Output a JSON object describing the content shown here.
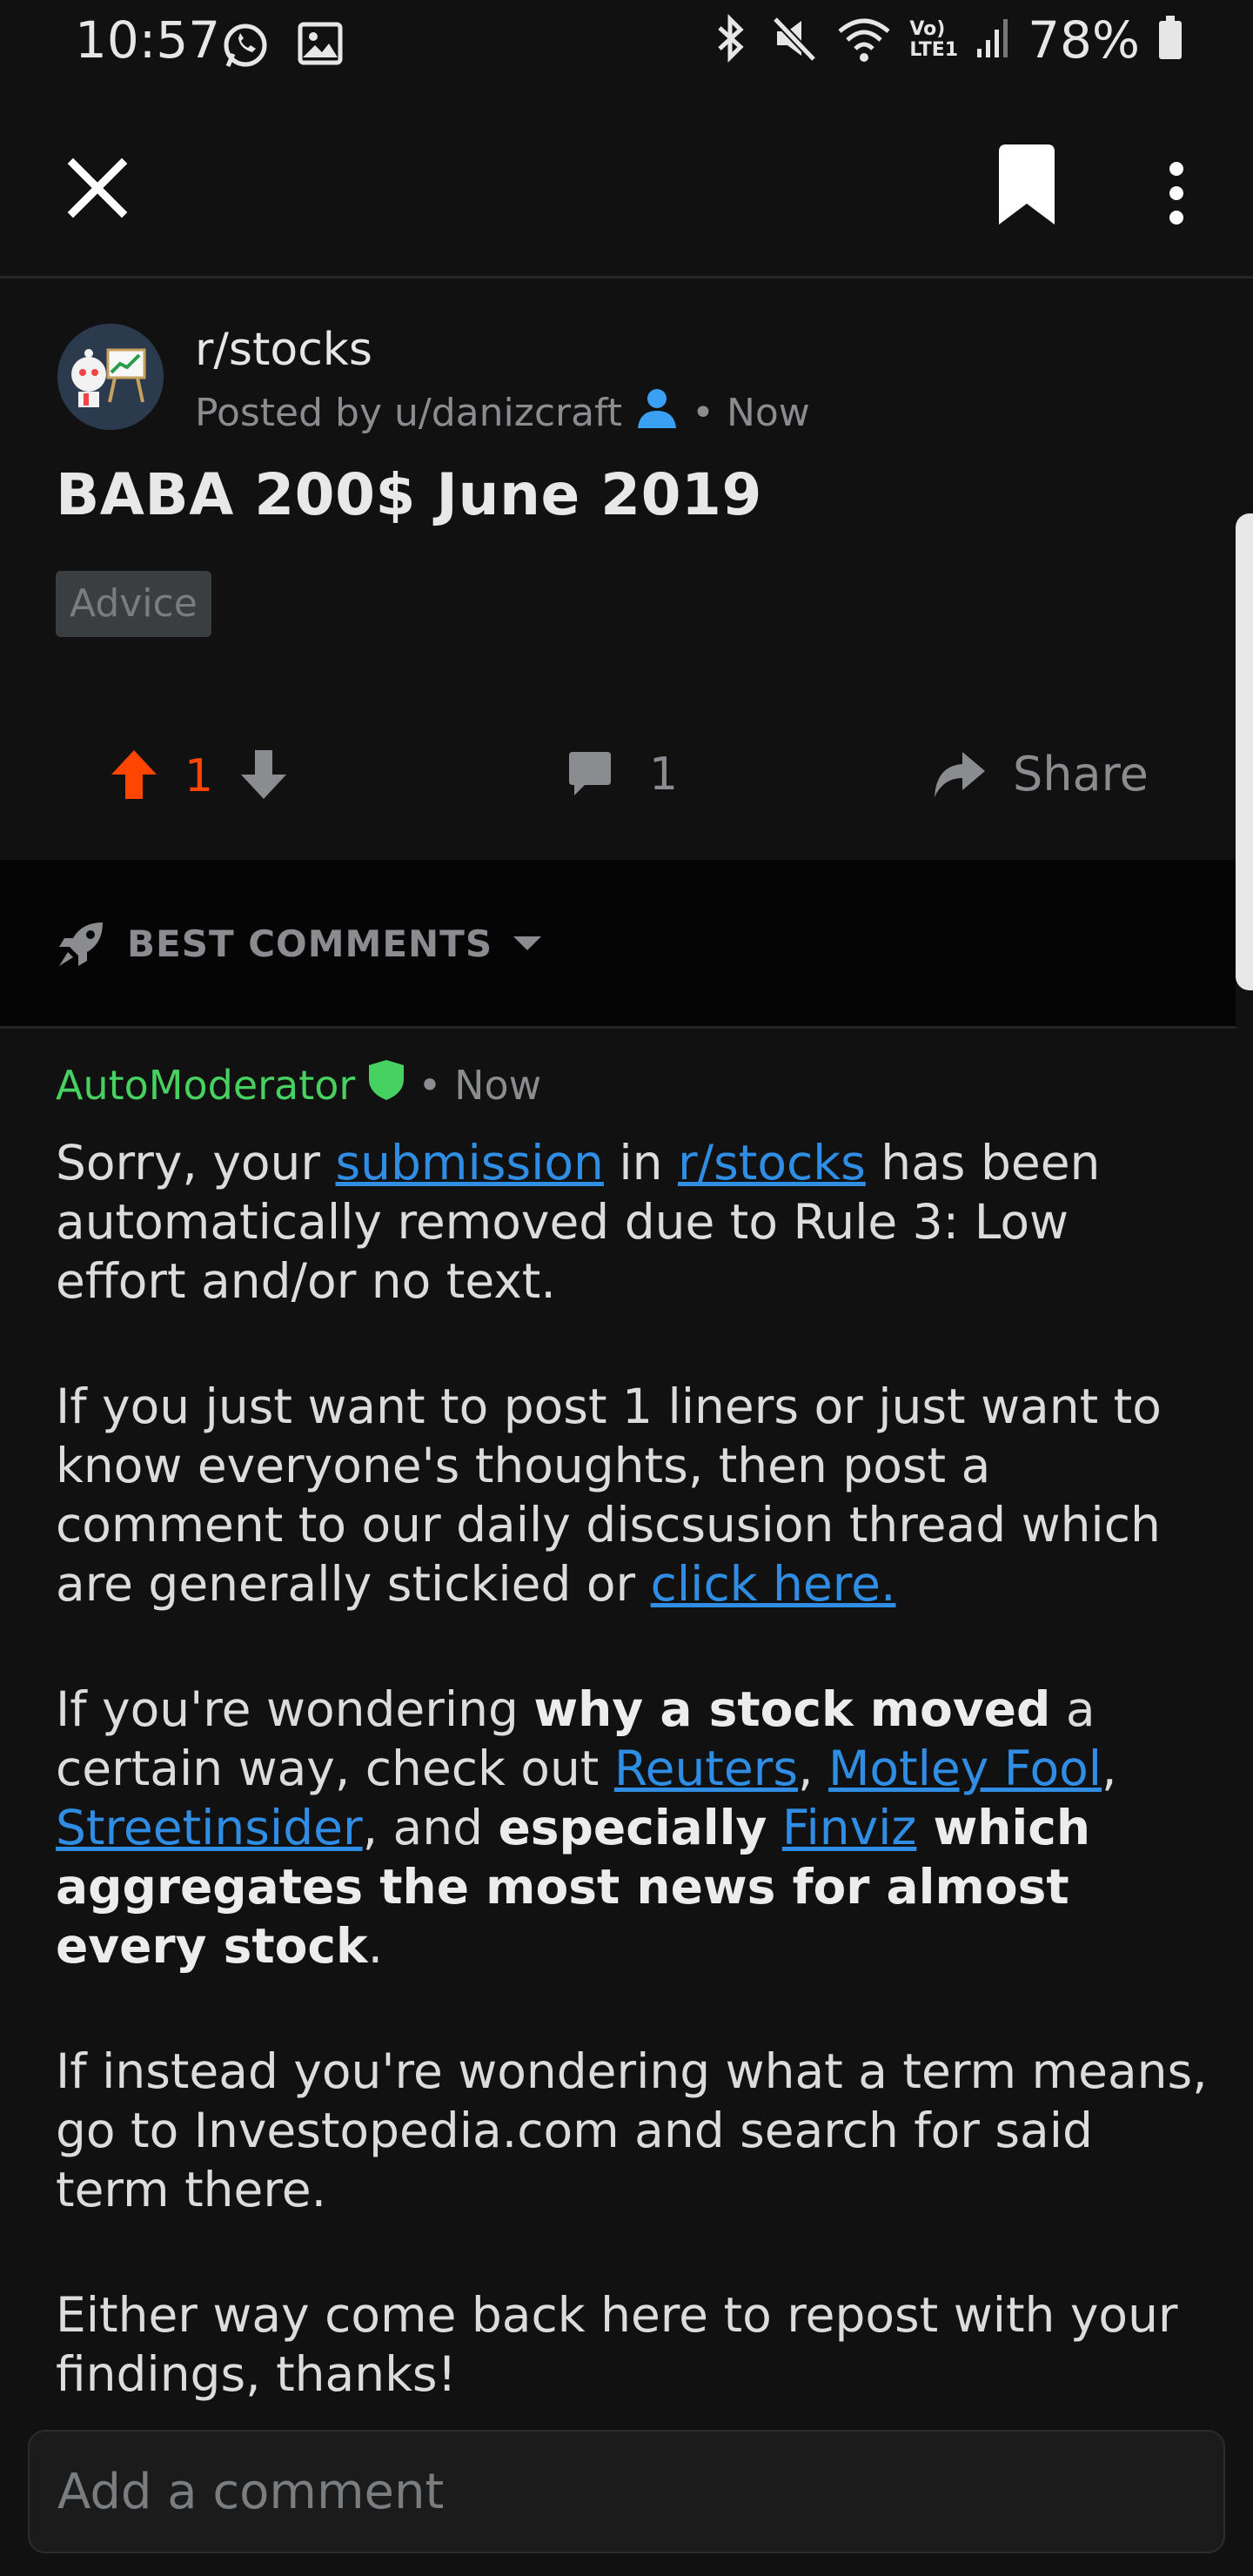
{
  "status_bar": {
    "time": "10:57",
    "battery": "78%",
    "icons": [
      "whatsapp-icon",
      "gallery-icon",
      "bluetooth-icon",
      "mute-icon",
      "wifi-icon",
      "lte-icon",
      "signal-icon",
      "battery-icon"
    ],
    "lte_label_top": "Vo)",
    "lte_label_bottom": "LTE1"
  },
  "toolbar": {
    "close_icon": "close-icon",
    "bookmark_icon": "bookmark-icon",
    "more_icon": "more-vertical-icon"
  },
  "post": {
    "subreddit": "r/stocks",
    "posted_by": "Posted by u/danizcraft",
    "time": "• Now",
    "title": "BABA 200$ June 2019",
    "flair": "Advice",
    "score": "1",
    "comment_count": "1",
    "share_label": "Share"
  },
  "sort": {
    "label": "BEST COMMENTS"
  },
  "comment": {
    "author": "AutoModerator",
    "time": "• Now",
    "p1": {
      "t1": "Sorry, your ",
      "link1": "submission",
      "t2": " in ",
      "link2": "r/stocks",
      "t3": " has been automatically removed due to Rule 3:  Low effort and/or no text."
    },
    "p2": {
      "t1": "If you just want to post 1 liners or just want to know everyone's thoughts, then post a comment to our daily discsusion thread which are generally stickied or ",
      "link1": "click here."
    },
    "p3": {
      "t1": "If you're wondering ",
      "b1": "why a stock moved",
      "t2": " a certain way, check out ",
      "link1": "Reuters",
      "sep1": ", ",
      "link2": "Motley Fool",
      "sep2": ", ",
      "link3": "Streetinsider",
      "t3": ", and ",
      "b2": "especially",
      "sp": " ",
      "link4": "Finviz",
      "b3": " which aggregates the most news for almost every stock",
      "end": "."
    },
    "p4": "If instead you're wondering what a term means, go to Investopedia.com and search for said term there.",
    "p5": "Either way come back here to repost with your findings, thanks!"
  },
  "add_comment": {
    "placeholder": "Add a comment"
  },
  "colors": {
    "background": "#111112",
    "upvote": "#ff4500",
    "automod": "#46d160",
    "link": "#2f8de4",
    "muted": "#8a8c8f"
  }
}
